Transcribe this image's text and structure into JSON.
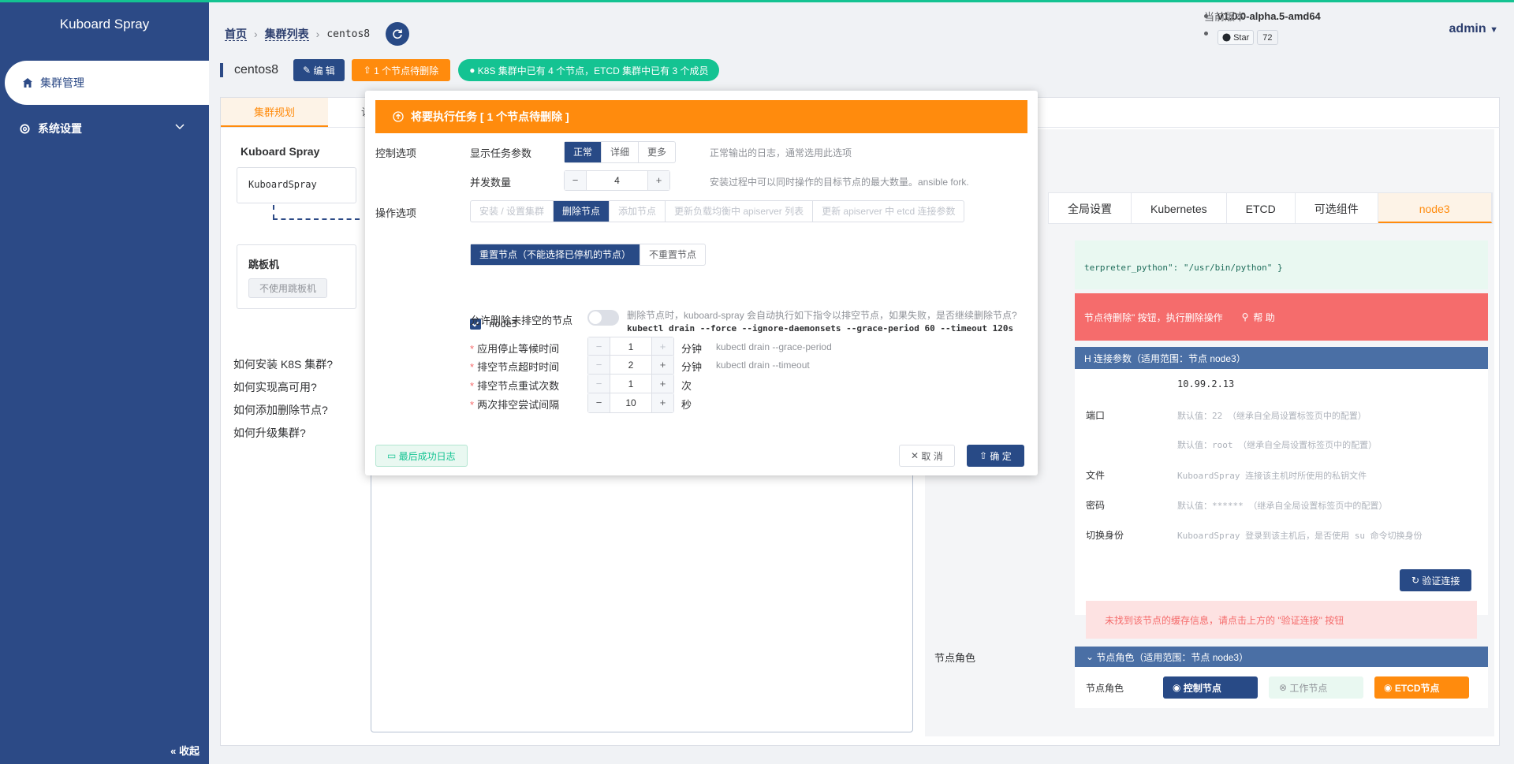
{
  "app": {
    "title": "Kuboard Spray"
  },
  "sidebar": {
    "items": [
      {
        "label": "集群管理",
        "icon": "home-icon",
        "active": true
      },
      {
        "label": "系统设置",
        "icon": "gear-icon",
        "active": false
      }
    ],
    "collapse_label": "« 收起"
  },
  "breadcrumb": {
    "home": "首页",
    "list": "集群列表",
    "current": "centos8"
  },
  "version": {
    "label": "当前版本",
    "value": "v1.0.0-alpha.5-amd64",
    "star_label": "Star",
    "star_count": "72"
  },
  "user": {
    "name": "admin"
  },
  "cluster": {
    "name": "centos8",
    "edit_label": "编 辑",
    "pending_label": "1 个节点待删除",
    "status_label": "K8S 集群中已有 4 个节点，ETCD 集群中已有 3 个成员"
  },
  "main_tabs": [
    "集群规划",
    "访问"
  ],
  "left": {
    "kuboard_title": "Kuboard Spray",
    "kuboard_box": "KuboardSpray",
    "jump_title": "跳板机",
    "jump_tag": "不使用跳板机",
    "help_links": [
      "如何安装 K8S 集群?",
      "如何实现高可用?",
      "如何添加删除节点?",
      "如何升级集群?"
    ]
  },
  "right": {
    "tabs": [
      "全局设置",
      "Kubernetes",
      "ETCD",
      "可选组件",
      "node3"
    ],
    "green_text": "terpreter_python\": \"/usr/bin/python\" }",
    "red_text": "节点待删除\" 按钮，执行删除操作",
    "red_help": "帮 助",
    "ssh_header": "H 连接参数（适用范围：节点 node3）",
    "ip_value": "10.99.2.13",
    "port_label": "端口",
    "port_hint": "默认值：22 （继承自全局设置标签页中的配置）",
    "user_hint": "默认值：root （继承自全局设置标签页中的配置）",
    "keyfile_label": "文件",
    "keyfile_hint": "KuboardSpray 连接该主机时所使用的私钥文件",
    "password_label": "密码",
    "password_hint": "默认值：****** （继承自全局设置标签页中的配置）",
    "become_label": "切换身份",
    "become_hint": "KuboardSpray 登录到该主机后，是否使用 su 命令切换身份",
    "verify_label": "验证连接",
    "warn_text": "未找到该节点的缓存信息，请点击上方的 \"验证连接\" 按钮",
    "role_section_label": "节点角色",
    "role_header": "节点角色（适用范围：节点 node3）",
    "role_label": "节点角色",
    "roles": [
      "控制节点",
      "工作节点",
      "ETCD节点"
    ]
  },
  "dialog": {
    "title": "将要执行任务 [ 1 个节点待删除 ]",
    "control_label": "控制选项",
    "verbosity_label": "显示任务参数",
    "verbosity_options": [
      "正常",
      "详细",
      "更多"
    ],
    "verbosity_selected": "正常",
    "verbosity_hint": "正常输出的日志，通常选用此选项",
    "fork_label": "并发数量",
    "fork_value": "4",
    "fork_hint": "安装过程中可以同时操作的目标节点的最大数量。ansible fork.",
    "operation_label": "操作选项",
    "operations": [
      "安装 / 设置集群",
      "删除节点",
      "添加节点",
      "更新负载均衡中 apiserver 列表",
      "更新 apiserver 中 etcd 连接参数"
    ],
    "operation_selected": "删除节点",
    "reset_options": [
      "重置节点（不能选择已停机的节点）",
      "不重置节点"
    ],
    "reset_selected": "重置节点（不能选择已停机的节点）",
    "node_checkbox": "node3",
    "allow_label": "允许删除未排空的节点",
    "allow_hint": "删除节点时，kuboard-spray 会自动执行如下指令以排空节点，如果失败，是否继续删除节点?",
    "drain_cmd": "kubectl drain --force --ignore-daemonsets --grace-period 60 --timeout 120s",
    "params": [
      {
        "label": "应用停止等候时间",
        "value": "1",
        "unit": "分钟",
        "hint": "kubectl drain --grace-period"
      },
      {
        "label": "排空节点超时时间",
        "value": "2",
        "unit": "分钟",
        "hint": "kubectl drain --timeout"
      },
      {
        "label": "排空节点重试次数",
        "value": "1",
        "unit": "次",
        "hint": ""
      },
      {
        "label": "两次排空尝试间隔",
        "value": "10",
        "unit": "秒",
        "hint": ""
      }
    ],
    "log_button": "最后成功日志",
    "cancel_button": "取 消",
    "confirm_button": "确 定"
  }
}
